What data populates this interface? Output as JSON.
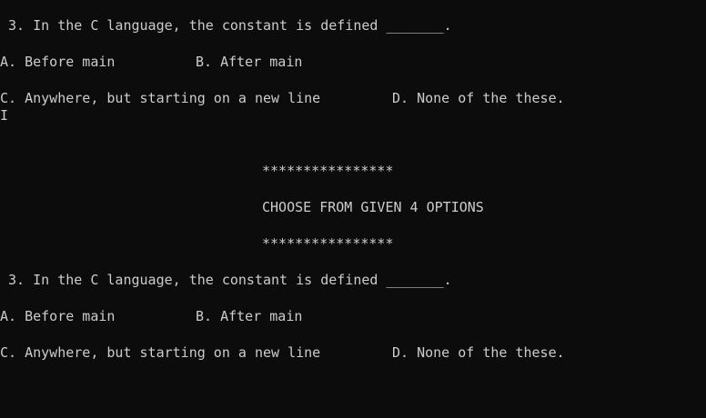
{
  "colors": {
    "background": "#0c0c0c",
    "text": "#cccccc"
  },
  "blocks": [
    {
      "question": " 3. In the C language, the constant is defined _______.",
      "option_a": "A. Before main",
      "option_b": "B. After main",
      "option_c": "C. Anywhere, but starting on a new line",
      "option_d": "D. None of the these."
    },
    {
      "question": " 3. In the C language, the constant is defined _______.",
      "option_a": "A. Before main",
      "option_b": "B. After main",
      "option_c": "C. Anywhere, but starting on a new line",
      "option_d": "D. None of the these."
    }
  ],
  "cursor_glyph": "I",
  "banner": {
    "stars_top": "****************",
    "title": "CHOOSE FROM GIVEN 4 OPTIONS",
    "stars_bottom": "****************"
  }
}
